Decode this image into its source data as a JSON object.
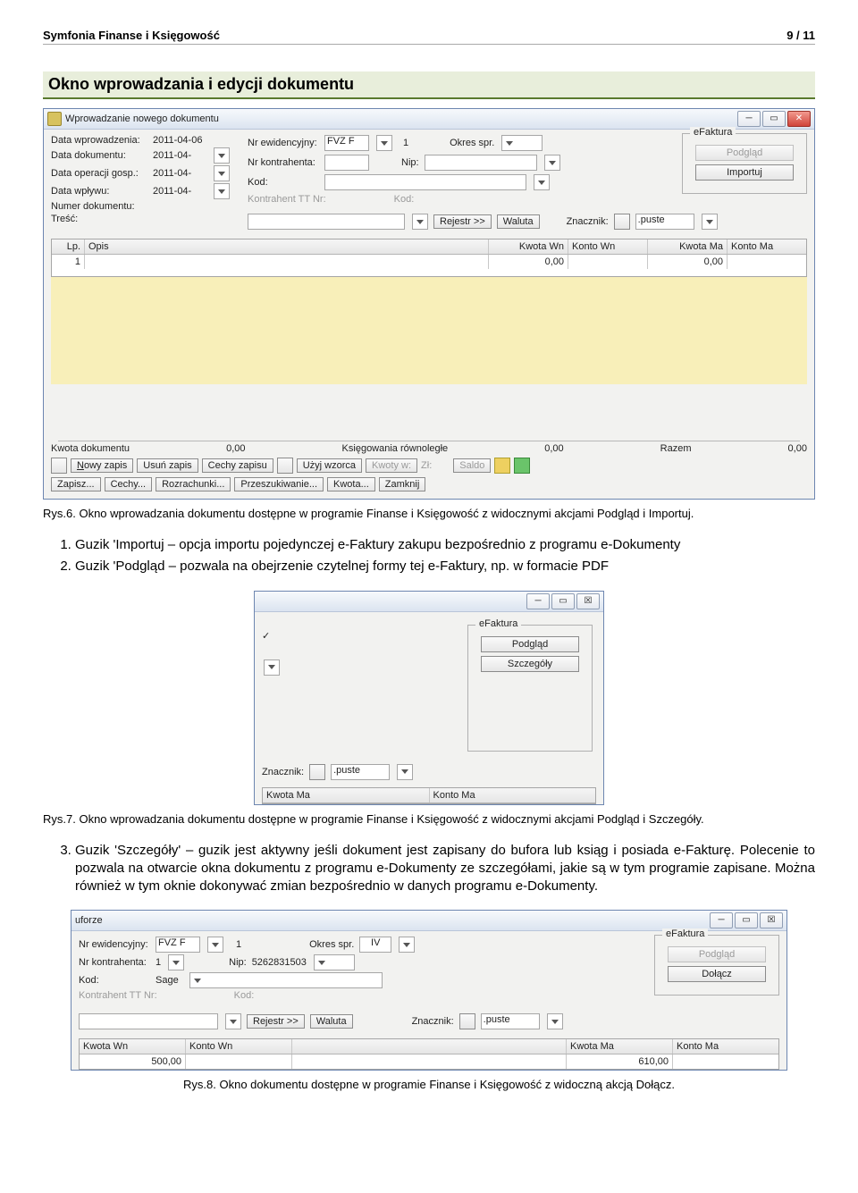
{
  "header": {
    "title": "Symfonia Finanse i Księgowość",
    "page": "9 / 11"
  },
  "section1_title": "Okno wprowadzania i edycji dokumentu",
  "win1": {
    "title": "Wprowadzanie nowego dokumentu",
    "efaktura": "eFaktura",
    "btn_podglad": "Podgląd",
    "btn_importuj": "Importuj",
    "labels": {
      "data_wprow": "Data wprowadzenia:",
      "data_dok": "Data dokumentu:",
      "data_op": "Data operacji gosp.:",
      "data_wpl": "Data wpływu:",
      "numer": "Numer dokumentu:",
      "tresc": "Treść:",
      "nr_ewid": "Nr ewidencyjny:",
      "nr_kontr": "Nr kontrahenta:",
      "kod": "Kod:",
      "kontr_tt": "Kontrahent TT Nr:",
      "kod2": "Kod:",
      "okres": "Okres spr.",
      "nip": "Nip:",
      "rejestr": "Rejestr >>",
      "waluta": "Waluta",
      "znacznik": "Znacznik:",
      "puste": ".puste"
    },
    "vals": {
      "data_wprow": "2011-04-06",
      "data_dok": "2011-04-",
      "data_op": "2011-04-",
      "data_wpl": "2011-04-",
      "nr_ewid_prefix": "FVZ F",
      "nr_ewid_num": "1"
    },
    "grid": {
      "cols": {
        "lp": "Lp.",
        "opis": "Opis",
        "kwwn": "Kwota Wn",
        "knwn": "Konto Wn",
        "kwma": "Kwota Ma",
        "knma": "Konto Ma"
      },
      "row1": {
        "lp": "1",
        "kwwn": "0,00",
        "kwma": "0,00"
      }
    },
    "footer": {
      "kw_dok": "Kwota dokumentu",
      "kw_dok_v": "0,00",
      "ks_row": "Księgowania równoległe",
      "ks_row_v": "0,00",
      "razem": "Razem",
      "razem_v": "0,00",
      "nowy_zapis": "Nowy zapis",
      "usun_zapis": "Usuń zapis",
      "cechy_zapisu": "Cechy zapisu",
      "uzyj_wzorca": "Użyj wzorca",
      "kwoty_w": "Kwoty w:",
      "zl": "Zł:",
      "saldo": "Saldo",
      "zapisz": "Zapisz...",
      "cechy": "Cechy...",
      "rozrach": "Rozrachunki...",
      "przeszuk": "Przeszukiwanie...",
      "kwota": "Kwota...",
      "zamknij": "Zamknij"
    }
  },
  "caption1": "Rys.6. Okno wprowadzania dokumentu dostępne w programie Finanse i Księgowość z widocznymi akcjami Podgląd i Importuj.",
  "list1": {
    "i1": "Guzik 'Importuj – opcja importu pojedynczej e-Faktury zakupu bezpośrednio z programu e-Dokumenty",
    "i2": "Guzik 'Podgląd – pozwala na obejrzenie czytelnej formy tej e-Faktury, np. w formacie PDF"
  },
  "win2": {
    "efaktura": "eFaktura",
    "btn_podglad": "Podgląd",
    "btn_szczegoly": "Szczegóły",
    "znacznik": "Znacznik:",
    "puste": ".puste",
    "kwma": "Kwota Ma",
    "knma": "Konto Ma"
  },
  "caption2": "Rys.7. Okno wprowadzania dokumentu dostępne w programie Finanse i Księgowość z widocznymi akcjami Podgląd i Szczegóły.",
  "list2": {
    "i3": "Guzik 'Szczegóły' – guzik jest aktywny jeśli dokument jest zapisany do bufora lub ksiąg i posiada e-Fakturę. Polecenie to pozwala na otwarcie okna dokumentu z programu e-Dokumenty ze szczegółami, jakie są w tym programie zapisane. Można również w tym oknie dokonywać zmian bezpośrednio w danych programu e-Dokumenty."
  },
  "win3": {
    "title_left": "uforze",
    "efaktura": "eFaktura",
    "btn_podglad": "Podgląd",
    "btn_dolacz": "Dołącz",
    "nr_ewid_lbl": "Nr ewidencyjny:",
    "nr_ewid_prefix": "FVZ F",
    "nr_ewid_num": "1",
    "okres": "Okres spr.",
    "okres_v": "IV",
    "nr_kontr_lbl": "Nr kontrahenta:",
    "nr_kontr_v": "1",
    "nip_lbl": "Nip:",
    "nip_v": "5262831503",
    "kod_lbl": "Kod:",
    "kod_v": "Sage",
    "kontr_tt": "Kontrahent TT Nr:",
    "kod2": "Kod:",
    "rejestr": "Rejestr >>",
    "waluta": "Waluta",
    "znacznik": "Znacznik:",
    "puste": ".puste",
    "grid": {
      "kwwn": "Kwota Wn",
      "knwn": "Konto Wn",
      "kwma": "Kwota Ma",
      "knma": "Konto Ma",
      "row_kwwn": "500,00",
      "row_kwma": "610,00"
    }
  },
  "caption3": "Rys.8. Okno dokumentu dostępne w programie Finanse i Księgowość z widoczną akcją Dołącz."
}
